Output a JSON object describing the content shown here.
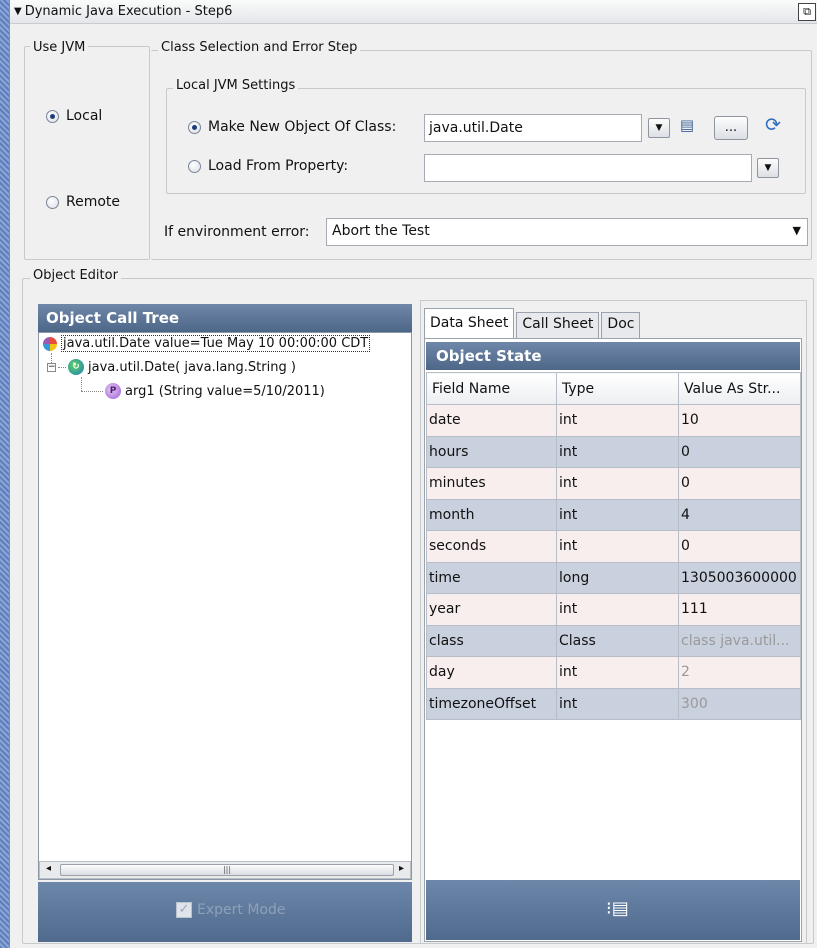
{
  "window": {
    "title": "Dynamic Java Execution - Step6",
    "collapse_glyph": "▼",
    "restore_glyph": "⧉"
  },
  "use_jvm": {
    "legend": "Use JVM",
    "options": [
      {
        "label": "Local",
        "selected": true
      },
      {
        "label": "Remote",
        "selected": false
      }
    ]
  },
  "class_selection": {
    "legend": "Class Selection and Error Step",
    "local_jvm_legend": "Local JVM Settings",
    "make_new_label": "Make New Object Of Class:",
    "make_new_selected": true,
    "class_value": "java.util.Date",
    "load_from_label": "Load From Property:",
    "load_from_value": "",
    "browse_label": "...",
    "env_error_label": "If environment error:",
    "env_error_value": "Abort the Test"
  },
  "object_editor": {
    "legend": "Object Editor",
    "call_tree": {
      "title": "Object Call Tree",
      "root": "java.util.Date value=Tue May 10 00:00:00 CDT",
      "constructor": "java.util.Date( java.lang.String )",
      "arg": "arg1 (String value=5/10/2011)",
      "expert_mode_label": "Expert Mode",
      "expert_mode_checked": true
    },
    "tabs": [
      {
        "label": "Data Sheet",
        "active": true
      },
      {
        "label": "Call Sheet",
        "active": false
      },
      {
        "label": "Doc",
        "active": false
      }
    ],
    "object_state": {
      "title": "Object State",
      "columns": [
        "Field Name",
        "Type",
        "Value As Str..."
      ],
      "rows": [
        [
          "date",
          "int",
          "10"
        ],
        [
          "hours",
          "int",
          "0"
        ],
        [
          "minutes",
          "int",
          "0"
        ],
        [
          "month",
          "int",
          "4"
        ],
        [
          "seconds",
          "int",
          "0"
        ],
        [
          "time",
          "long",
          "1305003600000"
        ],
        [
          "year",
          "int",
          "111"
        ],
        [
          "class",
          "Class",
          "class java.util..."
        ],
        [
          "day",
          "int",
          "2"
        ],
        [
          "timezoneOffset",
          "int",
          "300"
        ]
      ]
    }
  },
  "colors": {
    "header_blue": "#5a7396",
    "row_pink": "#f9eeee",
    "row_blue": "#c9d0de"
  }
}
